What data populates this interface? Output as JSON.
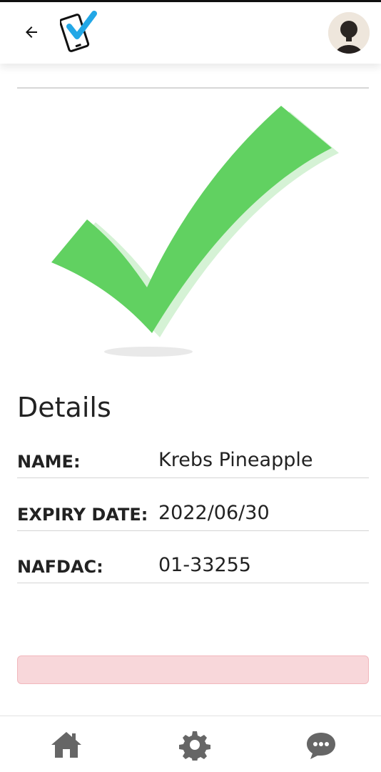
{
  "header": {
    "back_icon": "arrow-left-icon",
    "logo_icon": "phone-check-logo",
    "avatar_alt": "user-avatar"
  },
  "result": {
    "status_icon": "check-mark-icon",
    "color": "#61d161"
  },
  "details": {
    "title": "Details",
    "rows": [
      {
        "label": "NAME:",
        "value": "Krebs Pineapple"
      },
      {
        "label": "EXPIRY DATE:",
        "value": "2022/06/30"
      },
      {
        "label": "NAFDAC:",
        "value": "01-33255"
      }
    ]
  },
  "alert": {
    "color": "#f8d7da"
  },
  "bottom_nav": {
    "items": [
      "home-icon",
      "gear-icon",
      "chat-bubble-icon"
    ],
    "icon_color": "#666666"
  }
}
